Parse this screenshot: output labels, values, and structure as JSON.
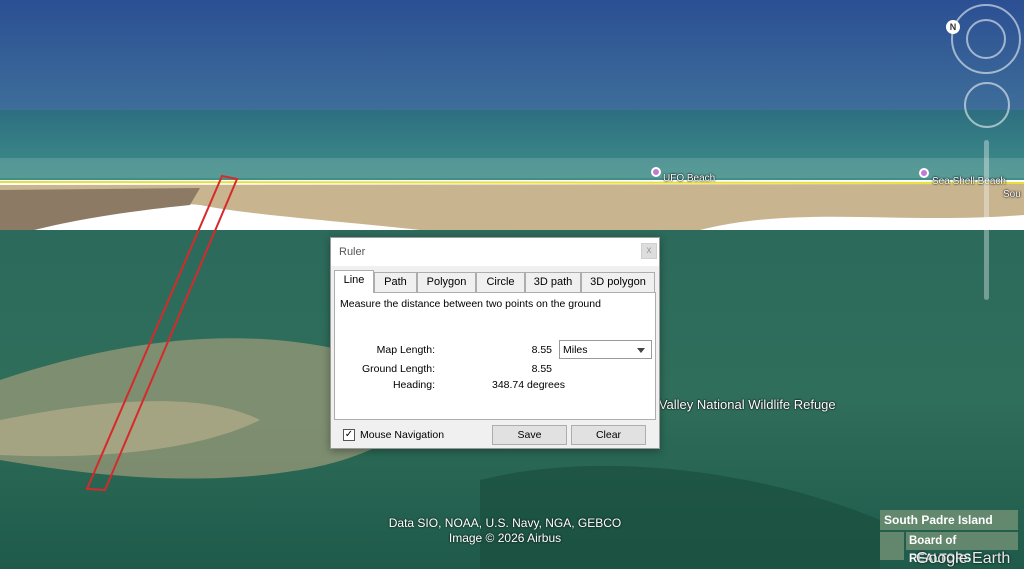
{
  "map": {
    "places": [
      {
        "name": "UFO Beach"
      },
      {
        "name": "Sea Shell Beach"
      }
    ],
    "partial_label": "Sou",
    "refuge_label": "e Valley National Wildlife Refuge",
    "credits_line1": "Data SIO, NOAA, U.S. Navy, NGA, GEBCO",
    "credits_line2": "Image © 2026 Airbus",
    "watermark_line1": "South Padre Island",
    "watermark_line2": "Board of REALTORS",
    "watermark_brand": "Google Earth",
    "north_letter": "N"
  },
  "ruler": {
    "title": "Ruler",
    "close_label": "x",
    "tabs": [
      "Line",
      "Path",
      "Polygon",
      "Circle",
      "3D path",
      "3D polygon"
    ],
    "active_tab": "Line",
    "description": "Measure the distance between two points on the ground",
    "map_length_label": "Map Length:",
    "map_length_value": "8.55",
    "unit": "Miles",
    "ground_length_label": "Ground Length:",
    "ground_length_value": "8.55",
    "heading_label": "Heading:",
    "heading_value": "348.74 degrees",
    "mouse_nav_label": "Mouse Navigation",
    "mouse_nav_checked": true,
    "check_mark": "✓",
    "save_label": "Save",
    "clear_label": "Clear"
  },
  "colors": {
    "measure_line": "#e8e03a",
    "outline": "#d62a2a",
    "pin": "#c07bd6"
  }
}
